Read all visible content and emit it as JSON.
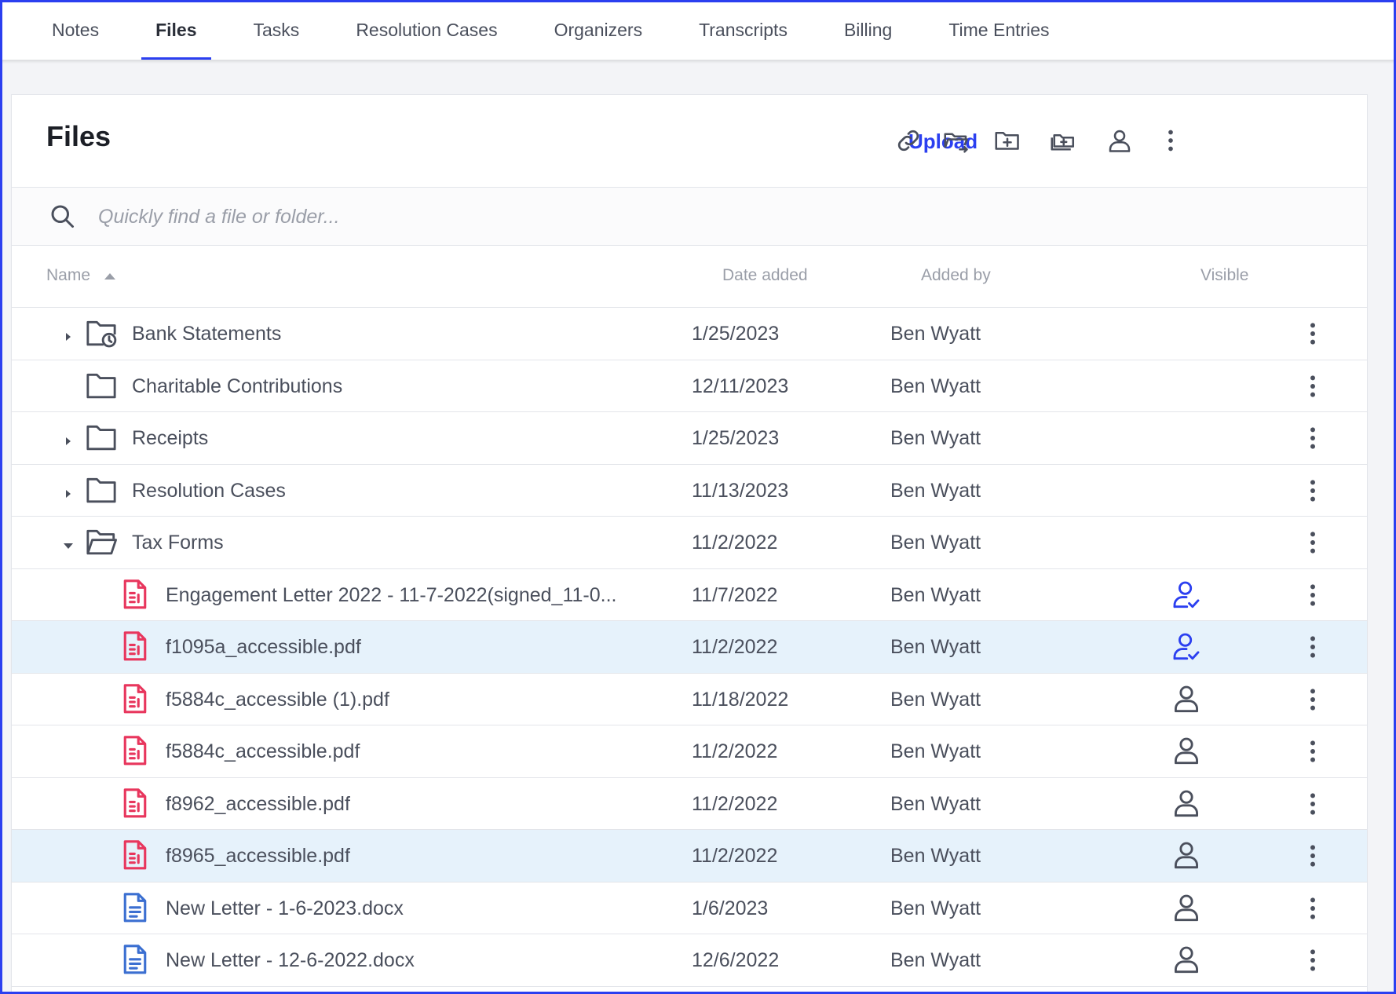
{
  "tabs": [
    {
      "label": "Notes",
      "active": false
    },
    {
      "label": "Files",
      "active": true
    },
    {
      "label": "Tasks",
      "active": false
    },
    {
      "label": "Resolution Cases",
      "active": false
    },
    {
      "label": "Organizers",
      "active": false
    },
    {
      "label": "Transcripts",
      "active": false
    },
    {
      "label": "Billing",
      "active": false
    },
    {
      "label": "Time Entries",
      "active": false
    }
  ],
  "card": {
    "title": "Files",
    "upload_label": "Upload",
    "header_icons": [
      "link-icon",
      "move-folder-icon",
      "add-folder-icon",
      "add-folders-icon",
      "user-icon",
      "more-vertical-icon"
    ]
  },
  "search": {
    "placeholder": "Quickly find a file or folder...",
    "value": ""
  },
  "columns": {
    "name": "Name",
    "date": "Date added",
    "added_by": "Added by",
    "visible": "Visible"
  },
  "colors": {
    "accent": "#2b3ff0",
    "pdf": "#e8365d",
    "docx": "#3b6fd1",
    "selected_row": "#e6f2fb"
  },
  "rows": [
    {
      "kind": "folder",
      "icon": "folder-clock-icon",
      "caret": "right",
      "name": "Bank Statements",
      "date": "1/25/2023",
      "by": "Ben Wyatt",
      "visible": null,
      "selected": false
    },
    {
      "kind": "folder",
      "icon": "folder-icon",
      "caret": null,
      "name": "Charitable Contributions",
      "date": "12/11/2023",
      "by": "Ben Wyatt",
      "visible": null,
      "selected": false
    },
    {
      "kind": "folder",
      "icon": "folder-icon",
      "caret": "right",
      "name": "Receipts",
      "date": "1/25/2023",
      "by": "Ben Wyatt",
      "visible": null,
      "selected": false
    },
    {
      "kind": "folder",
      "icon": "folder-icon",
      "caret": "right",
      "name": "Resolution Cases",
      "date": "11/13/2023",
      "by": "Ben Wyatt",
      "visible": null,
      "selected": false
    },
    {
      "kind": "folder",
      "icon": "folder-open-icon",
      "caret": "down",
      "name": "Tax Forms",
      "date": "11/2/2022",
      "by": "Ben Wyatt",
      "visible": null,
      "selected": false
    },
    {
      "kind": "pdf",
      "icon": "pdf-file-icon",
      "name": "Engagement Letter 2022 - 11-7-2022(signed_11-0...",
      "date": "11/7/2022",
      "by": "Ben Wyatt",
      "visible": "shared",
      "selected": false
    },
    {
      "kind": "pdf",
      "icon": "pdf-file-icon",
      "name": "f1095a_accessible.pdf",
      "date": "11/2/2022",
      "by": "Ben Wyatt",
      "visible": "shared",
      "selected": true
    },
    {
      "kind": "pdf",
      "icon": "pdf-file-icon",
      "name": "f5884c_accessible (1).pdf",
      "date": "11/18/2022",
      "by": "Ben Wyatt",
      "visible": "private",
      "selected": false
    },
    {
      "kind": "pdf",
      "icon": "pdf-file-icon",
      "name": "f5884c_accessible.pdf",
      "date": "11/2/2022",
      "by": "Ben Wyatt",
      "visible": "private",
      "selected": false
    },
    {
      "kind": "pdf",
      "icon": "pdf-file-icon",
      "name": "f8962_accessible.pdf",
      "date": "11/2/2022",
      "by": "Ben Wyatt",
      "visible": "private",
      "selected": false
    },
    {
      "kind": "pdf",
      "icon": "pdf-file-icon",
      "name": "f8965_accessible.pdf",
      "date": "11/2/2022",
      "by": "Ben Wyatt",
      "visible": "private",
      "selected": true
    },
    {
      "kind": "docx",
      "icon": "doc-file-icon",
      "name": "New Letter - 1-6-2023.docx",
      "date": "1/6/2023",
      "by": "Ben Wyatt",
      "visible": "private",
      "selected": false
    },
    {
      "kind": "docx",
      "icon": "doc-file-icon",
      "name": "New Letter - 12-6-2022.docx",
      "date": "12/6/2022",
      "by": "Ben Wyatt",
      "visible": "private",
      "selected": false
    }
  ]
}
